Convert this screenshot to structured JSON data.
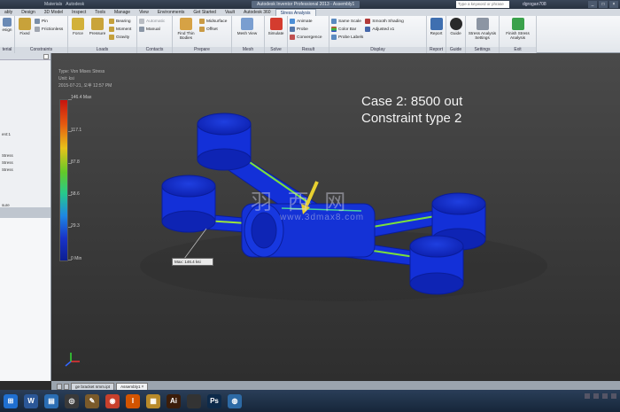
{
  "titlebar": {
    "quick_access": [
      "Materials",
      "Autodesk"
    ],
    "title": "Autodesk Inventor Professional 2013 - Assembly1",
    "search_placeholder": "Type a keyword or phrase",
    "user": "dgrogan708",
    "controls": [
      "_",
      "□",
      "×"
    ]
  },
  "tabs": [
    "ably",
    "Design",
    "3D Model",
    "Inspect",
    "Tools",
    "Manage",
    "View",
    "Environments",
    "Get Started",
    "Vault",
    "Autodesk 360",
    "Stress Analysis"
  ],
  "active_tab": "Stress Analysis",
  "ribbon": {
    "panels": {
      "material": {
        "label": "terial",
        "button": "esign"
      },
      "constraints": {
        "label": "Constraints",
        "fixed": "Fixed",
        "pin": "Pin",
        "frictionless": "Frictionless"
      },
      "loads": {
        "label": "Loads",
        "force": "Force",
        "pressure": "Pressure",
        "bearing": "Bearing",
        "moment": "Moment",
        "gravity": "Gravity"
      },
      "contacts": {
        "label": "Contacts",
        "automatic": "Automatic",
        "manual": "Manual"
      },
      "prepare": {
        "label": "Prepare",
        "find_thin": "Find Thin Bodies",
        "midsurface": "Midsurface",
        "offset": "Offset"
      },
      "mesh": {
        "label": "Mesh",
        "mesh_view": "Mesh View"
      },
      "solve": {
        "label": "Solve",
        "simulate": "Simulate"
      },
      "result": {
        "label": "Result",
        "animate": "Animate",
        "probe": "Probe",
        "convergence": "Convergence"
      },
      "display": {
        "label": "Display",
        "same_scale": "Same Scale",
        "color_bar": "Color Bar",
        "probe_labels": "Probe Labels",
        "smooth_shading": "Smooth Shading",
        "adjusted": "Adjusted x1"
      },
      "report": {
        "label": "Report",
        "report": "Report"
      },
      "guide": {
        "label": "Guide",
        "guide": "Guide"
      },
      "settings": {
        "label": "Settings",
        "stress_settings": "Stress Analysis Settings"
      },
      "exit": {
        "label": "Exit",
        "finish": "Finish Stress Analysis"
      }
    }
  },
  "sidebar": {
    "rows": [
      "",
      "",
      "",
      "",
      "",
      "",
      "",
      "",
      "",
      "",
      "ent:1",
      "",
      "",
      "Stress",
      "Stress",
      "Stress",
      "",
      "",
      "",
      "",
      "sure"
    ]
  },
  "viewport": {
    "info_lines": [
      "Type: Von Mises Stress",
      "Unit: ksi",
      "2015-07-21, 오후 12:57 PM"
    ],
    "case_line1": "Case 2: 8500 out",
    "case_line2": "Constraint type 2",
    "max_label": "Max: 146.4 ksi",
    "watermark": "羽 西 网",
    "watermark_url": "www.3dmax8.com"
  },
  "chart_data": {
    "type": "heatmap",
    "title": "Von Mises Stress",
    "unit": "ksi",
    "legend_ticks": [
      "146.4 Max",
      "117.1",
      "87.8",
      "58.6",
      "29.3",
      "0 Min"
    ],
    "max_value": 146.4,
    "min_value": 0
  },
  "docbar": {
    "tabs": [
      "ge bracket nmm.ipt",
      "Assembly1"
    ],
    "active": "Assembly1"
  },
  "taskbar": {
    "apps": [
      {
        "name": "start",
        "color": "#1f6fd0",
        "glyph": "⊞"
      },
      {
        "name": "word",
        "color": "#2b5797",
        "glyph": "W"
      },
      {
        "name": "explorer",
        "color": "#2a6db3",
        "glyph": "▤"
      },
      {
        "name": "media",
        "color": "#3a3a3a",
        "glyph": "◎"
      },
      {
        "name": "paint",
        "color": "#7a5a2a",
        "glyph": "✎"
      },
      {
        "name": "chrome",
        "color": "#c7402c",
        "glyph": "◉"
      },
      {
        "name": "inventor",
        "color": "#d35400",
        "glyph": "I"
      },
      {
        "name": "files",
        "color": "#b88a2a",
        "glyph": "▦"
      },
      {
        "name": "illustrator",
        "color": "#3b1d0a",
        "glyph": "Ai"
      },
      {
        "name": "blank",
        "color": "#333",
        "glyph": ""
      },
      {
        "name": "photoshop",
        "color": "#0d2a4a",
        "glyph": "Ps"
      },
      {
        "name": "globe",
        "color": "#2d6aa5",
        "glyph": "◍"
      }
    ]
  }
}
